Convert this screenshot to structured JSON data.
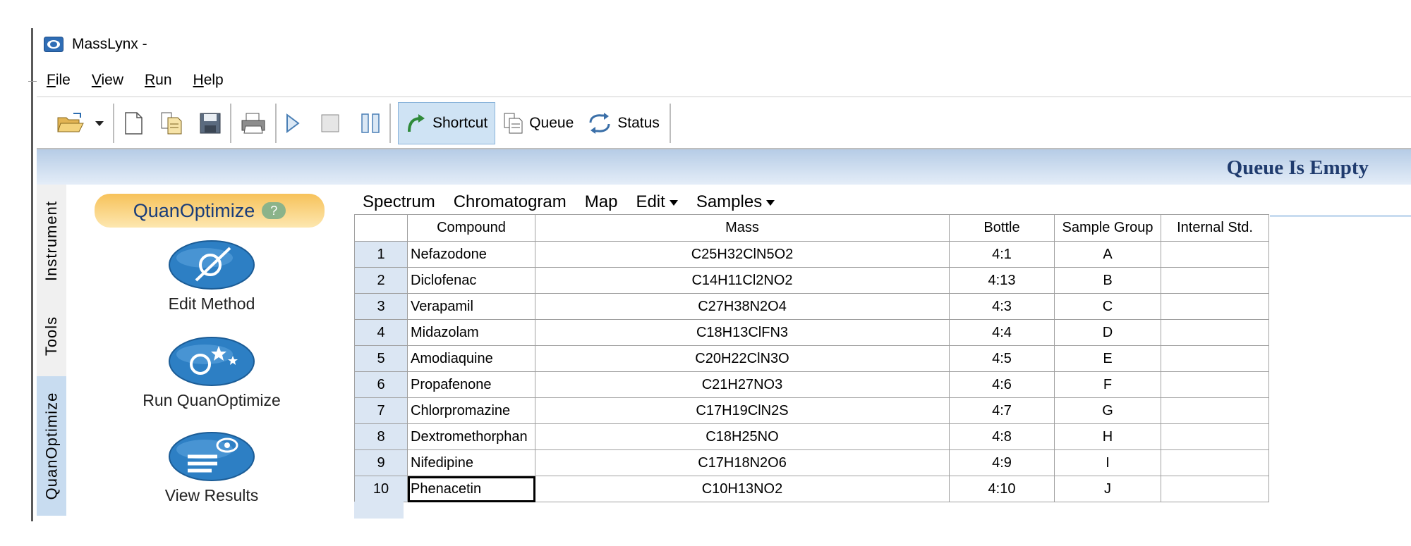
{
  "window": {
    "title": "MassLynx -"
  },
  "menu": [
    {
      "label": "File",
      "key": "F",
      "rest": "ile"
    },
    {
      "label": "View",
      "key": "V",
      "rest": "iew"
    },
    {
      "label": "Run",
      "key": "R",
      "rest": "un"
    },
    {
      "label": "Help",
      "key": "H",
      "rest": "elp"
    }
  ],
  "toolbar": {
    "shortcut_label": "Shortcut",
    "queue_label": "Queue",
    "status_label": "Status"
  },
  "queue_status": "Queue Is Empty",
  "side_tabs": {
    "instrument": "Instrument",
    "tools": "Tools",
    "quanoptimize": "QuanOptimize"
  },
  "panel": {
    "title": "QuanOptimize",
    "actions": {
      "edit_method": "Edit Method",
      "run": "Run QuanOptimize",
      "view_results": "View Results"
    }
  },
  "grid_menu": {
    "spectrum": "Spectrum",
    "chromatogram": "Chromatogram",
    "map": "Map",
    "edit": "Edit",
    "samples": "Samples"
  },
  "table": {
    "headers": {
      "compound": "Compound",
      "mass": "Mass",
      "bottle": "Bottle",
      "sample_group": "Sample Group",
      "internal_std": "Internal Std."
    },
    "rows": [
      {
        "n": "1",
        "compound": "Nefazodone",
        "mass": "C25H32ClN5O2",
        "bottle": "4:1",
        "group": "A",
        "istd": ""
      },
      {
        "n": "2",
        "compound": "Diclofenac",
        "mass": "C14H11Cl2NO2",
        "bottle": "4:13",
        "group": "B",
        "istd": ""
      },
      {
        "n": "3",
        "compound": "Verapamil",
        "mass": "C27H38N2O4",
        "bottle": "4:3",
        "group": "C",
        "istd": ""
      },
      {
        "n": "4",
        "compound": "Midazolam",
        "mass": "C18H13ClFN3",
        "bottle": "4:4",
        "group": "D",
        "istd": ""
      },
      {
        "n": "5",
        "compound": "Amodiaquine",
        "mass": "C20H22ClN3O",
        "bottle": "4:5",
        "group": "E",
        "istd": ""
      },
      {
        "n": "6",
        "compound": "Propafenone",
        "mass": "C21H27NO3",
        "bottle": "4:6",
        "group": "F",
        "istd": ""
      },
      {
        "n": "7",
        "compound": "Chlorpromazine",
        "mass": "C17H19ClN2S",
        "bottle": "4:7",
        "group": "G",
        "istd": ""
      },
      {
        "n": "8",
        "compound": "Dextromethorphan",
        "mass": "C18H25NO",
        "bottle": "4:8",
        "group": "H",
        "istd": ""
      },
      {
        "n": "9",
        "compound": "Nifedipine",
        "mass": "C17H18N2O6",
        "bottle": "4:9",
        "group": "I",
        "istd": ""
      },
      {
        "n": "10",
        "compound": "Phenacetin",
        "mass": "C10H13NO2",
        "bottle": "4:10",
        "group": "J",
        "istd": ""
      }
    ]
  },
  "colors": {
    "accent_blue": "#1f3b6e",
    "panel_orange": "#f7c25a",
    "selection": "#cfe3f4"
  }
}
